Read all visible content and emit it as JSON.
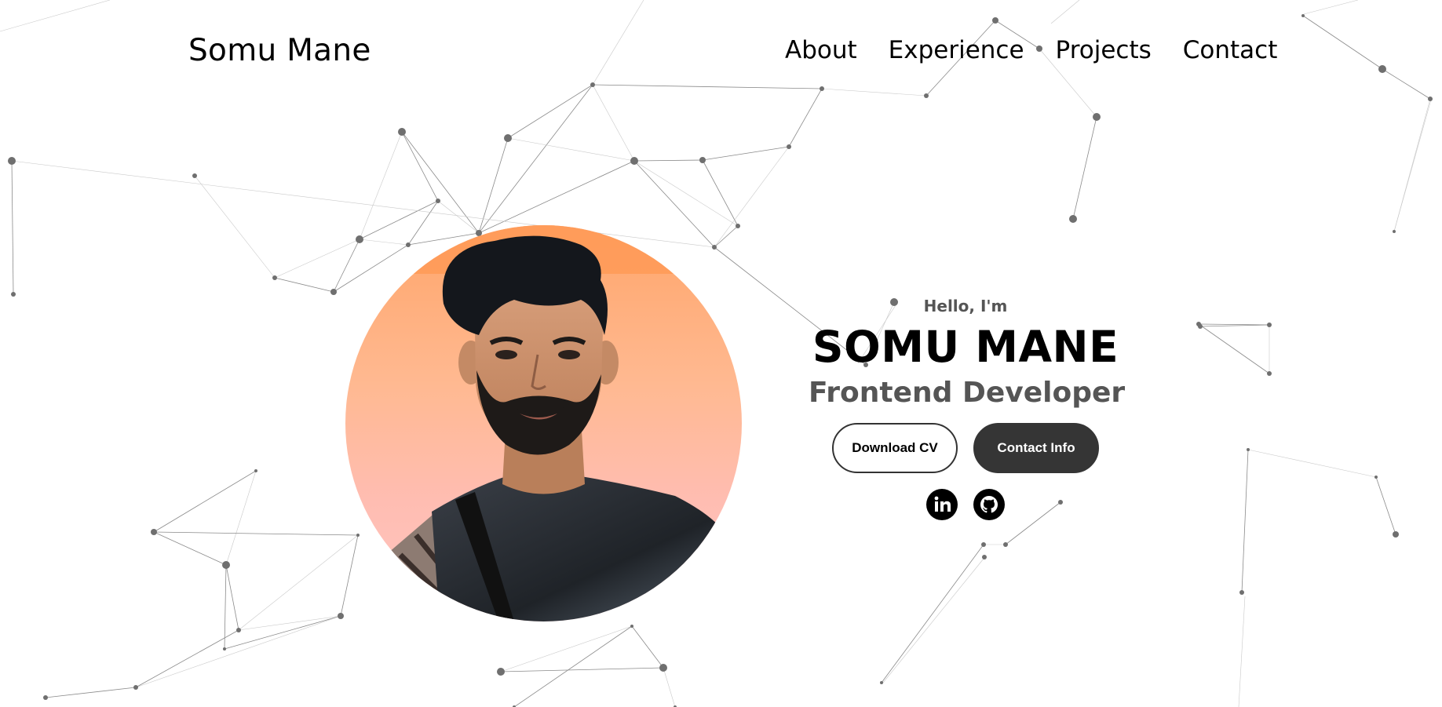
{
  "header": {
    "brand": "Somu Mane",
    "nav": [
      {
        "label": "About"
      },
      {
        "label": "Experience"
      },
      {
        "label": "Projects"
      },
      {
        "label": "Contact"
      }
    ]
  },
  "hero": {
    "greeting": "Hello, I'm",
    "name": "SOMU MANE",
    "role": "Frontend Developer",
    "buttons": {
      "download_cv": "Download CV",
      "contact_info": "Contact Info"
    },
    "socials": [
      {
        "icon": "linkedin-icon"
      },
      {
        "icon": "github-icon"
      }
    ]
  },
  "colors": {
    "background": "#ffffff",
    "text": "#000000",
    "muted_text": "#555555",
    "button_dark": "#353535",
    "network_lines": "#8a8a8a",
    "avatar_bg_top": "#ffa56a",
    "avatar_bg_bottom": "#ffc7c2"
  }
}
